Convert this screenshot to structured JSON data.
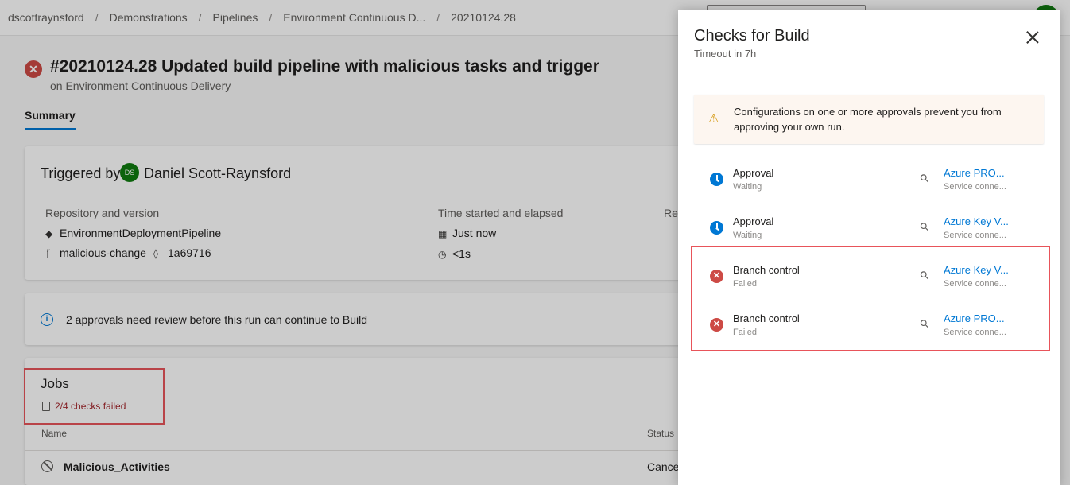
{
  "breadcrumb": [
    "dscottraynsford",
    "Demonstrations",
    "Pipelines",
    "Environment Continuous D...",
    "20210124.28"
  ],
  "run": {
    "status_icon": "error-circle-icon",
    "title": "#20210124.28 Updated build pipeline with malicious tasks and trigger",
    "subtitle": "on Environment Continuous Delivery"
  },
  "tabs": {
    "summary": "Summary"
  },
  "triggered": {
    "label": "Triggered by",
    "avatar_initials": "DS",
    "user": "Daniel Scott-Raynsford",
    "repo_heading": "Repository and version",
    "repo_name": "EnvironmentDeploymentPipeline",
    "branch": "malicious-change",
    "commit": "1a69716",
    "time_heading": "Time started and elapsed",
    "started": "Just now",
    "elapsed": "<1s",
    "third_heading": "Rel"
  },
  "info": {
    "text": "2 approvals need review before this run can continue to Build"
  },
  "jobs": {
    "title": "Jobs",
    "checks_failed": "2/4 checks failed",
    "col_name": "Name",
    "col_status": "Status",
    "rows": [
      {
        "name": "Malicious_Activities",
        "status": "Cance"
      }
    ]
  },
  "panel": {
    "title": "Checks for Build",
    "subtitle": "Timeout in 7h",
    "warning": "Configurations on one or more approvals prevent you from approving your own run.",
    "checks": [
      {
        "name": "Approval",
        "state": "Waiting",
        "status": "waiting",
        "resource": "Azure PRO...",
        "resource_type": "Service conne..."
      },
      {
        "name": "Approval",
        "state": "Waiting",
        "status": "waiting",
        "resource": "Azure Key V...",
        "resource_type": "Service conne..."
      },
      {
        "name": "Branch control",
        "state": "Failed",
        "status": "failed",
        "resource": "Azure Key V...",
        "resource_type": "Service conne..."
      },
      {
        "name": "Branch control",
        "state": "Failed",
        "status": "failed",
        "resource": "Azure PRO...",
        "resource_type": "Service conne..."
      }
    ]
  },
  "colors": {
    "accent": "#0078d4",
    "failed": "#cd4a45",
    "highlight_box": "#e8545a",
    "avatar": "#107c10"
  }
}
